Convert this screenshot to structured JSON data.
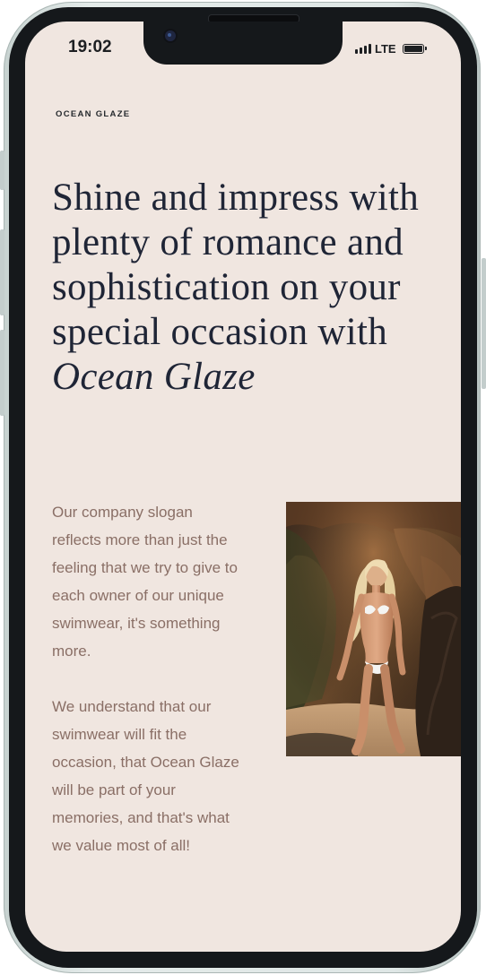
{
  "status_bar": {
    "time": "19:02",
    "network": "LTE",
    "icons": [
      "signal-icon",
      "battery-icon"
    ]
  },
  "brand": "OCEAN GLAZE",
  "headline": {
    "text": "Shine and impress with plenty of romance and sophistication on your special occasion with",
    "emphasis": "Ocean Glaze"
  },
  "body": {
    "paragraph_1": "Our company slogan reflects more than just the feeling that we try to give to each owner of our unique swimwear, it's something more.",
    "paragraph_2": "We understand that our swimwear will fit the occasion, that Ocean Glaze will be part of your memories, and that's what we value most of all!"
  },
  "colors": {
    "screen_background": "#f0e6e0",
    "headline": "#1f2536",
    "body_text": "#8a6f66",
    "bezel": "#15181b"
  }
}
